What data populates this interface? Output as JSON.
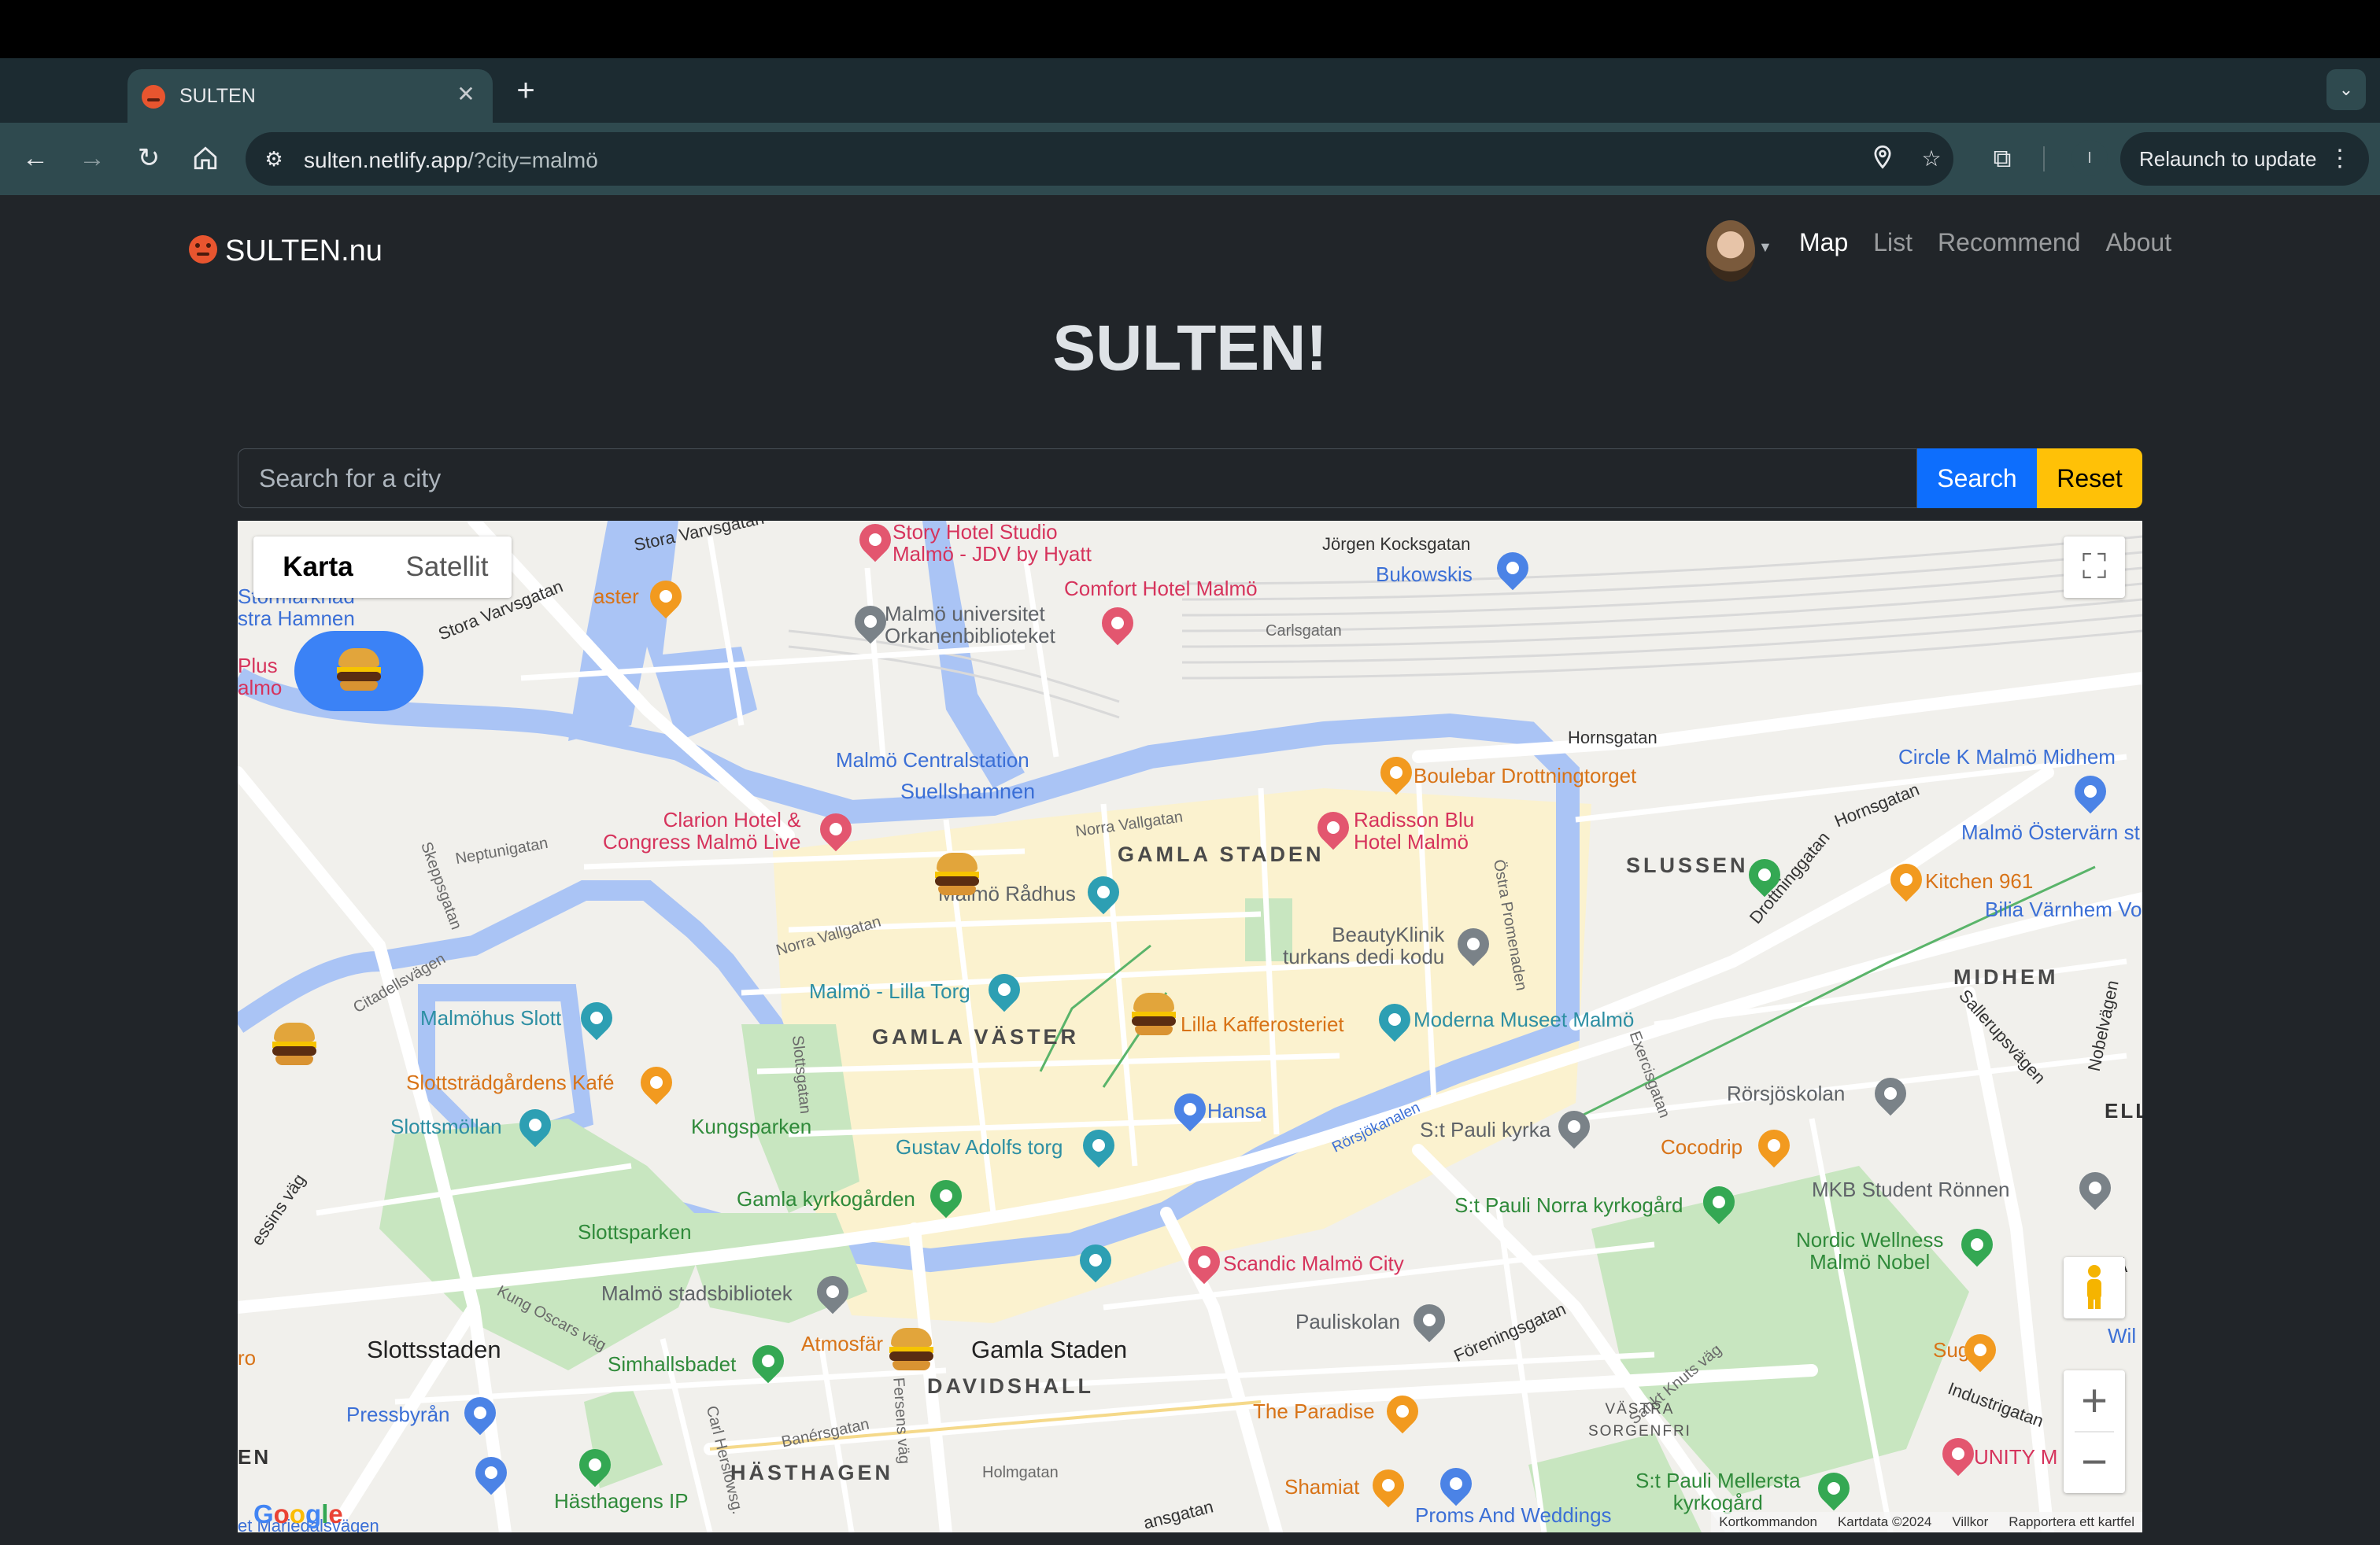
{
  "browser": {
    "tab_title": "SULTEN",
    "url_host": "sulten.netlify.app",
    "url_path": "/?city=malmö",
    "relaunch_label": "Relaunch to update",
    "profile_initial": "I"
  },
  "page": {
    "brand": "SULTEN.nu",
    "nav": [
      "Map",
      "List",
      "Recommend",
      "About"
    ],
    "active_nav": "Map",
    "hero_title": "SULTEN!",
    "search_placeholder": "Search for a city",
    "search_button": "Search",
    "reset_button": "Reset"
  },
  "map": {
    "type_map": "Karta",
    "type_satellite": "Satellit",
    "attribution": [
      "Kortkommandon",
      "Kartdata ©2024",
      "Villkor",
      "Rapportera ett kartfel"
    ],
    "google": "Google",
    "labels": {
      "story_hotel": "Story Hotel Studio\nMalmö - JDV by Hyatt",
      "comfort": "Comfort Hotel Malmö",
      "universitet": "Malmö universitet\nOrkanenbiblioteket",
      "bukowskis": "Bukowskis",
      "jorgen": "Jörgen Kocksgatan",
      "carlsgatan": "Carlsgatan",
      "stora_varv1": "Stora Varvsgatan",
      "stora_varv2": "Stora Varvsgatan",
      "aster": "aster",
      "stormarknad": "Stormarknad\nstra Hamnen",
      "plus": "Plus\nalmo",
      "centralstation": "Malmö Centralstation",
      "suellshamnen": "Suellshamnen",
      "hornsgatan": "Hornsgatan",
      "circle_k": "Circle K Malmö Midhem",
      "boulebar": "Boulebar Drottningtorget",
      "clarion": "Clarion Hotel &\nCongress Malmö Live",
      "norra_vallgatan": "Norra Vallgatan",
      "gamla_staden_d": "GAMLA STADEN",
      "radisson": "Radisson Blu\nHotel Malmö",
      "slussen": "SLUSSEN",
      "hornsgatan2": "Hornsgatan",
      "drottninggatan": "Drottninggatan",
      "osterv": "Malmö Östervärn st",
      "kitchen": "Kitchen 961",
      "bilia": "Bilia Värnhem Vo",
      "neptunigatan": "Neptunigatan",
      "skeppsgatan": "Skeppsgatan",
      "radhus": "Malmö Rådhus",
      "norra_vallgatan2": "Norra Vallgatan",
      "beautyklinik": "BeautyKlinik\nturkans dedi kodu",
      "ostra_prom": "Östra Promenaden",
      "midhem": "MIDHEM",
      "citadellsvagen": "Citadellsvägen",
      "lilla_torg": "Malmö - Lilla Torg",
      "moderna": "Moderna Museet Malmö",
      "malmohus": "Malmöhus Slott",
      "gamla_vaster": "GAMLA VÄSTER",
      "lilla_kaffe": "Lilla Kafferosteriet",
      "slottsgatan": "Slottsgatan",
      "exercisgatan": "Exercisgatan",
      "salleruspv": "Sallerupsvägen",
      "nobelvagen": "Nobelvägen",
      "slottstradgard": "Slottsträdgårdens Kafé",
      "rorsjokolan": "Rörsjöskolan",
      "hansa": "Hansa",
      "ell": "ELL",
      "slottsmollan": "Slottsmöllan",
      "kungsparken": "Kungsparken",
      "rorsjokanalen": "Rörsjökanalen",
      "st_pauli": "S:t Pauli kyrka",
      "gustav": "Gustav Adolfs torg",
      "cocodrip": "Cocodrip",
      "mkb": "MKB Student Rönnen",
      "essins": "essins väg",
      "gamla_kyrk": "Gamla kyrkogården",
      "st_pauli_norra": "S:t Pauli Norra kyrkogård",
      "slottsparken": "Slottsparken",
      "nordic": "Nordic Wellness\nMalmö Nobel",
      "scandic": "Scandic Malmö City",
      "va": "VÄ",
      "stadsbibliotek": "Malmö stadsbibliotek",
      "pauliskolan": "Pauliskolan",
      "kung_oscars": "Kung Oscars väg",
      "foreningsgatan": "Föreningsgatan",
      "wil": "Wil",
      "slottsstaden": "Slottsstaden",
      "atmosfar": "Atmosfär",
      "gamla_staden": "Gamla Staden",
      "simhallsbadet": "Simhallsbadet",
      "sugoi": "Sugoi",
      "ro": "ro",
      "davidshall": "DAVIDSHALL",
      "sankt_knuts": "Sankt Knuts väg",
      "industrigatan": "Industrigatan",
      "pressbyran": "Pressbyrån",
      "fersens": "Fersens väg",
      "the_paradise": "The Paradise",
      "vastra_sorgenfri": "VÄSTRA\nSORGENFRI",
      "carl_herslow": "Carl Herslowsg.",
      "banersgatan": "Banérsgatan",
      "unity": "UNITY M",
      "en": "EN",
      "hasthagen": "HÄSTHAGEN",
      "holmgatan": "Holmgatan",
      "shamiat": "Shamiat",
      "st_pauli_mellersta": "S:t Pauli Mellersta\nkyrkogård",
      "hasthagens_ip": "Hästhagens IP",
      "proms": "Proms And Weddings",
      "mariedal": "et Mariedalsvägen",
      "ansgatan": "ansgatan"
    }
  },
  "colors": {
    "accent_blue": "#0d6efd",
    "reset_yellow": "#ffc107",
    "page_bg": "#212529",
    "water": "#aac4f5",
    "park": "#c8e6c0",
    "old_town": "#fbf2cf"
  }
}
